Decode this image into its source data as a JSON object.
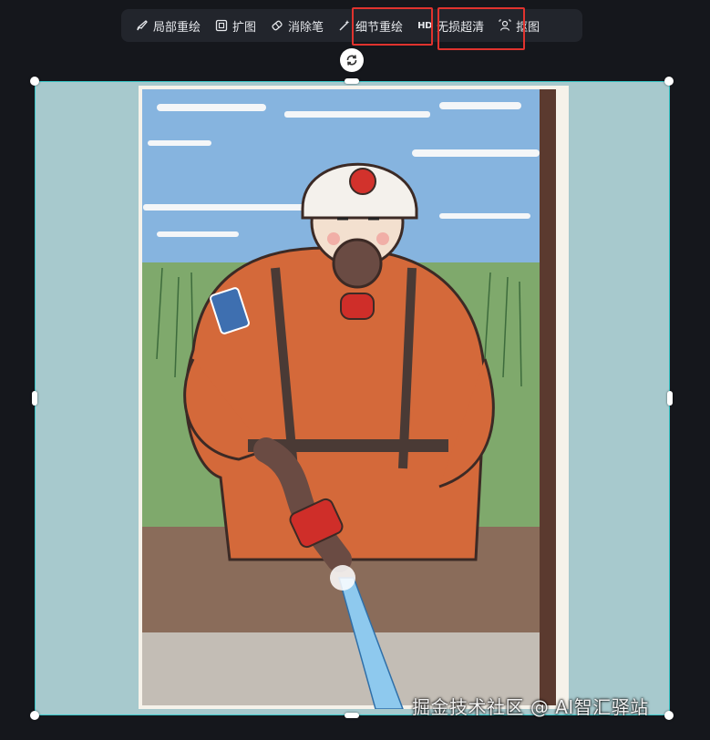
{
  "toolbar": {
    "items": [
      {
        "label": "局部重绘",
        "icon": "brush-icon"
      },
      {
        "label": "扩图",
        "icon": "expand-icon"
      },
      {
        "label": "消除笔",
        "icon": "eraser-icon"
      },
      {
        "label": "细节重绘",
        "icon": "magic-wand-icon"
      },
      {
        "label": "无损超清",
        "icon": "hd-icon",
        "tag": "HD"
      },
      {
        "label": "抠图",
        "icon": "cutout-icon"
      }
    ],
    "highlighted": [
      "细节重绘",
      "无损超清"
    ]
  },
  "watermark": "掘金技术社区 @ AI智汇驿站",
  "colors": {
    "background": "#15171c",
    "toolbar_bg": "#22252c",
    "highlight": "#e0332e",
    "selection": "#38c7c9",
    "canvas_fill": "#a7c9cd"
  }
}
